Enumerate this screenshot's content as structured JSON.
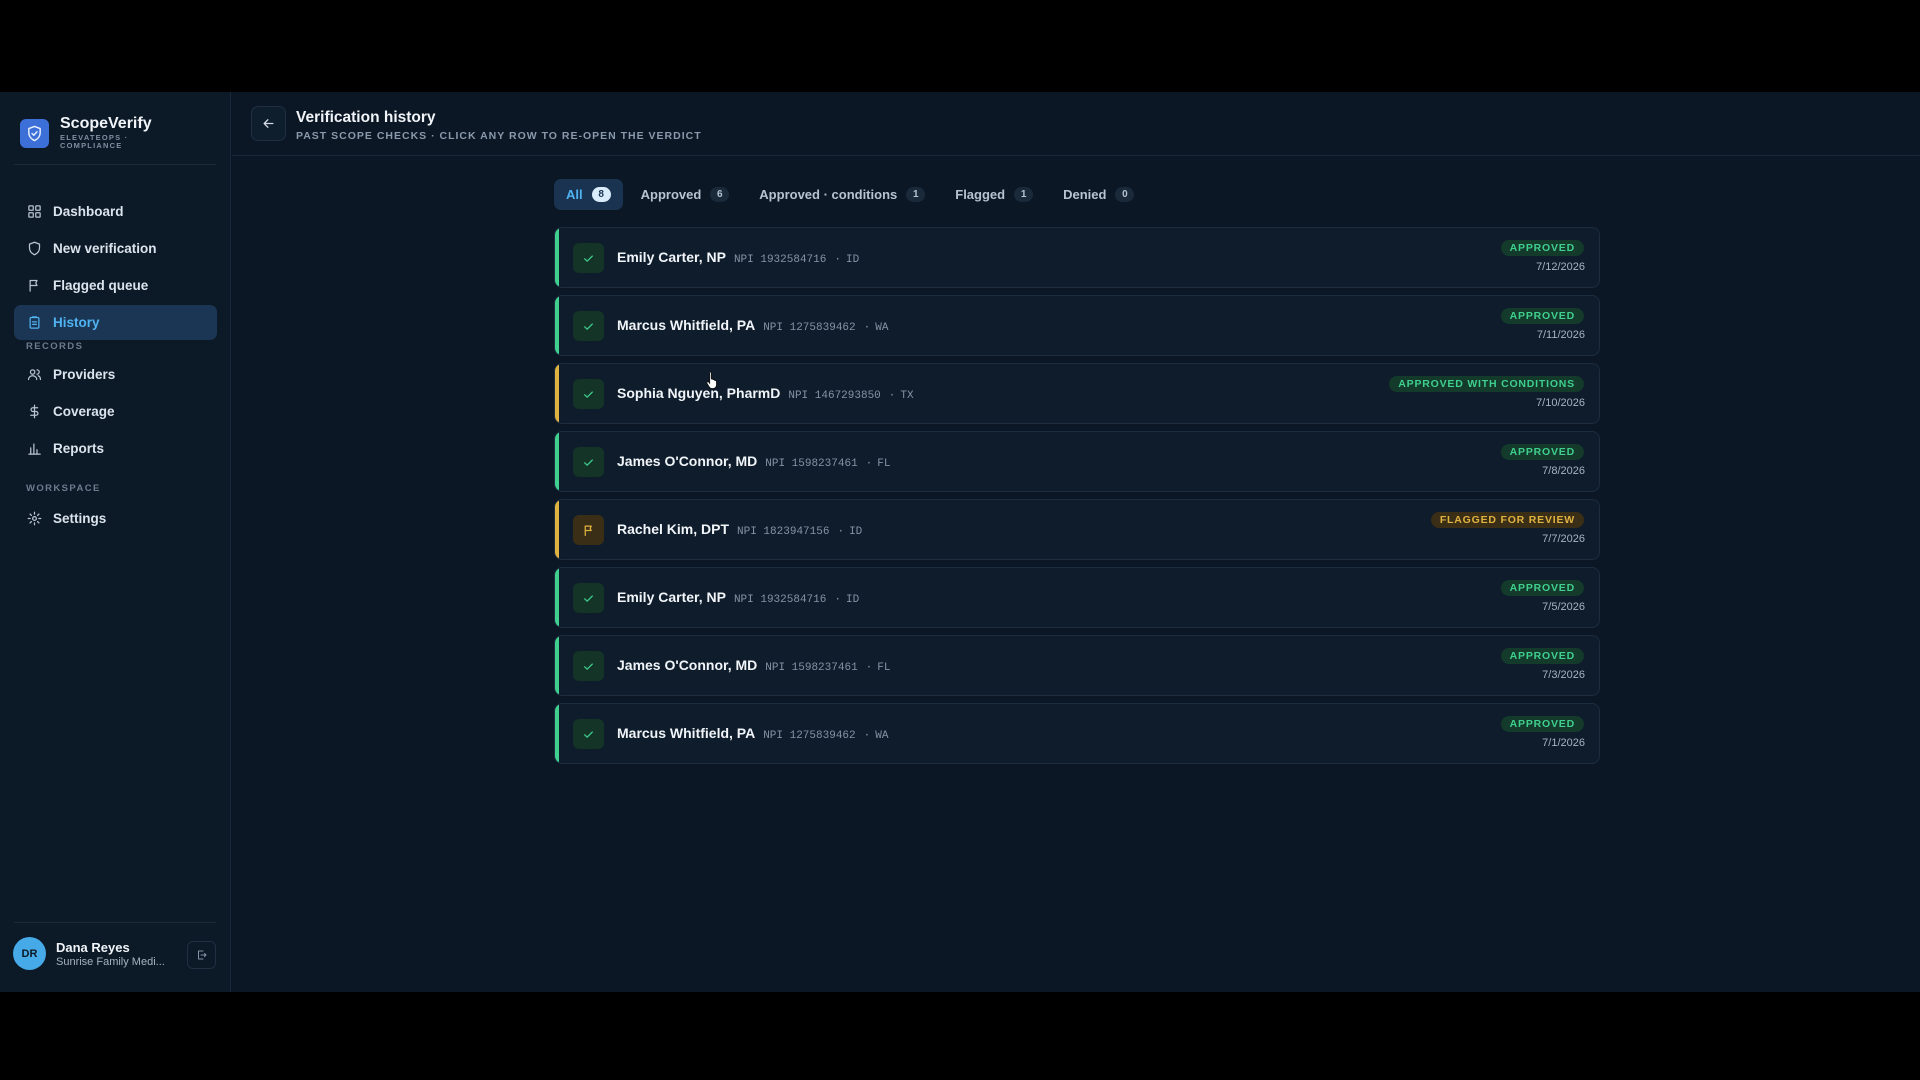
{
  "brand": {
    "name": "ScopeVerify",
    "subtitle": "ELEVATEOPS · COMPLIANCE",
    "logo_icon": "shield-check-icon"
  },
  "sidebar": {
    "main_items": [
      {
        "label": "Dashboard",
        "icon": "grid-icon"
      },
      {
        "label": "New verification",
        "icon": "shield-icon"
      },
      {
        "label": "Flagged queue",
        "icon": "flag-icon"
      },
      {
        "label": "History",
        "icon": "clipboard-icon",
        "active": true
      }
    ],
    "records_heading": "RECORDS",
    "records_items": [
      {
        "label": "Providers",
        "icon": "users-icon"
      },
      {
        "label": "Coverage",
        "icon": "dollar-icon"
      },
      {
        "label": "Reports",
        "icon": "bar-chart-icon"
      }
    ],
    "workspace_heading": "WORKSPACE",
    "workspace_items": [
      {
        "label": "Settings",
        "icon": "gear-icon"
      }
    ]
  },
  "user": {
    "initials": "DR",
    "name": "Dana Reyes",
    "org": "Sunrise Family Medi..."
  },
  "header": {
    "title": "Verification history",
    "subtitle": "PAST SCOPE CHECKS · CLICK ANY ROW TO RE-OPEN THE VERDICT"
  },
  "tabs": [
    {
      "label": "All",
      "count": "8",
      "active": true
    },
    {
      "label": "Approved",
      "count": "6"
    },
    {
      "label": "Approved · conditions",
      "count": "1"
    },
    {
      "label": "Flagged",
      "count": "1"
    },
    {
      "label": "Denied",
      "count": "0"
    }
  ],
  "rows": [
    {
      "name": "Emily Carter, NP",
      "npi": "NPI 1932584716",
      "state": "ID",
      "status": "APPROVED",
      "date": "7/12/2026",
      "kind": "approved"
    },
    {
      "name": "Marcus Whitfield, PA",
      "npi": "NPI 1275839462",
      "state": "WA",
      "status": "APPROVED",
      "date": "7/11/2026",
      "kind": "approved"
    },
    {
      "name": "Sophia Nguyen, PharmD",
      "npi": "NPI 1467293850",
      "state": "TX",
      "status": "APPROVED WITH CONDITIONS",
      "date": "7/10/2026",
      "kind": "cond"
    },
    {
      "name": "James O'Connor, MD",
      "npi": "NPI 1598237461",
      "state": "FL",
      "status": "APPROVED",
      "date": "7/8/2026",
      "kind": "approved"
    },
    {
      "name": "Rachel Kim, DPT",
      "npi": "NPI 1823947156",
      "state": "ID",
      "status": "FLAGGED FOR REVIEW",
      "date": "7/7/2026",
      "kind": "flag"
    },
    {
      "name": "Emily Carter, NP",
      "npi": "NPI 1932584716",
      "state": "ID",
      "status": "APPROVED",
      "date": "7/5/2026",
      "kind": "approved"
    },
    {
      "name": "James O'Connor, MD",
      "npi": "NPI 1598237461",
      "state": "FL",
      "status": "APPROVED",
      "date": "7/3/2026",
      "kind": "approved"
    },
    {
      "name": "Marcus Whitfield, PA",
      "npi": "NPI 1275839462",
      "state": "WA",
      "status": "APPROVED",
      "date": "7/1/2026",
      "kind": "approved"
    }
  ],
  "colors": {
    "approved": "#3fcf8e",
    "flagged": "#e0b340",
    "accent": "#4fb3f1",
    "background": "#0b1724"
  }
}
